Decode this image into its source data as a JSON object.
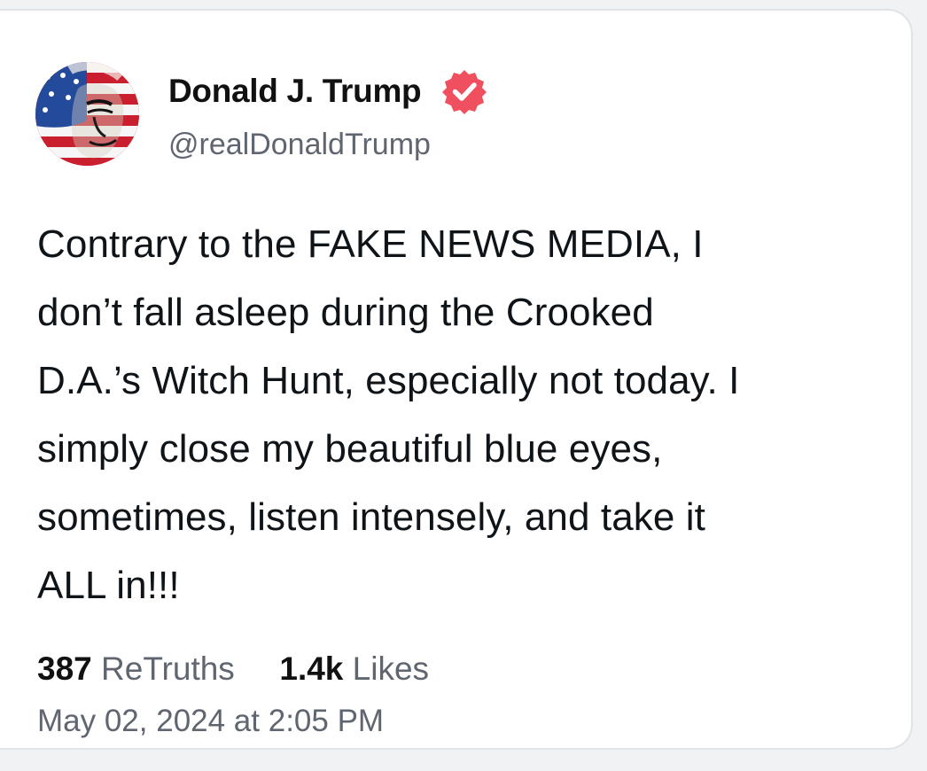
{
  "post": {
    "author": {
      "name": "Donald J. Trump",
      "handle": "@realDonaldTrump",
      "verified_icon": "verified-badge-icon",
      "verified_color": "#ef4f5f"
    },
    "text_lines": [
      "Contrary to the FAKE NEWS MEDIA, I",
      "don’t fall asleep during the Crooked",
      "D.A.’s Witch Hunt, especially not today. I",
      "simply close my beautiful blue eyes,",
      "sometimes, listen intensely, and take it",
      "ALL in!!!"
    ],
    "stats": {
      "retruths_count": "387",
      "retruths_label": "ReTruths",
      "likes_count": "1.4k",
      "likes_label": "Likes"
    },
    "timestamp": "May 02, 2024 at 2:05 PM"
  },
  "colors": {
    "text_primary": "#0f1419",
    "text_secondary": "#5f6670",
    "card_border": "#dfe3e8",
    "background": "#f1f2f4"
  }
}
